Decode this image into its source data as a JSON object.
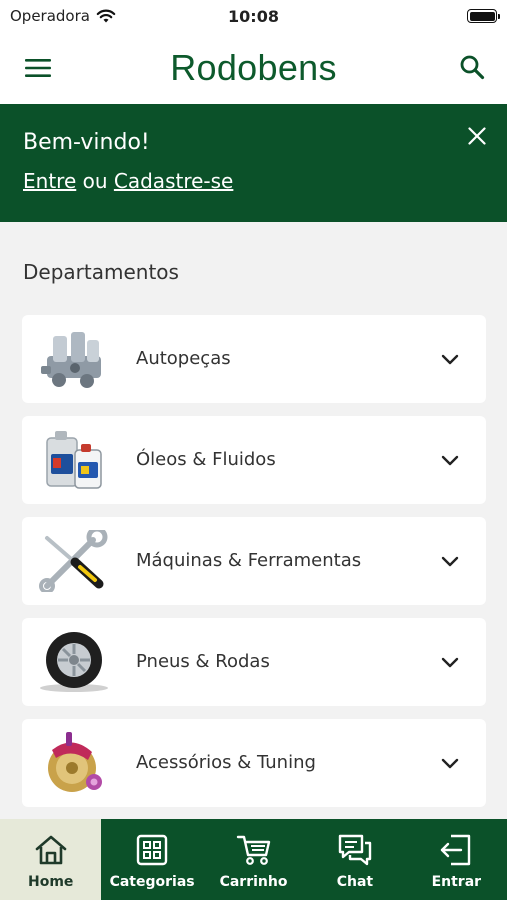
{
  "status_bar": {
    "carrier": "Operadora",
    "time": "10:08"
  },
  "header": {
    "logo": "Rodobens",
    "menu_icon": "hamburger-menu-icon",
    "search_icon": "search-icon"
  },
  "welcome": {
    "title": "Bem-vindo!",
    "login_link": "Entre",
    "separator": "ou",
    "signup_link": "Cadastre-se",
    "close_icon": "close-icon"
  },
  "departments": {
    "title": "Departamentos",
    "items": [
      {
        "label": "Autopeças",
        "icon": "engine-parts-icon"
      },
      {
        "label": "Óleos & Fluidos",
        "icon": "oil-bottles-icon"
      },
      {
        "label": "Máquinas & Ferramentas",
        "icon": "tools-icon"
      },
      {
        "label": "Pneus & Rodas",
        "icon": "tire-icon"
      },
      {
        "label": "Acessórios & Tuning",
        "icon": "brake-caliper-icon"
      }
    ]
  },
  "tabs": [
    {
      "label": "Home",
      "icon": "home-icon",
      "active": true
    },
    {
      "label": "Categorias",
      "icon": "grid-icon",
      "active": false
    },
    {
      "label": "Carrinho",
      "icon": "cart-icon",
      "active": false
    },
    {
      "label": "Chat",
      "icon": "chat-icon",
      "active": false
    },
    {
      "label": "Entrar",
      "icon": "login-icon",
      "active": false
    }
  ],
  "colors": {
    "brand_green": "#0b5129",
    "logo_green": "#0d5a2c",
    "active_tab_bg": "#e6e9d9"
  }
}
